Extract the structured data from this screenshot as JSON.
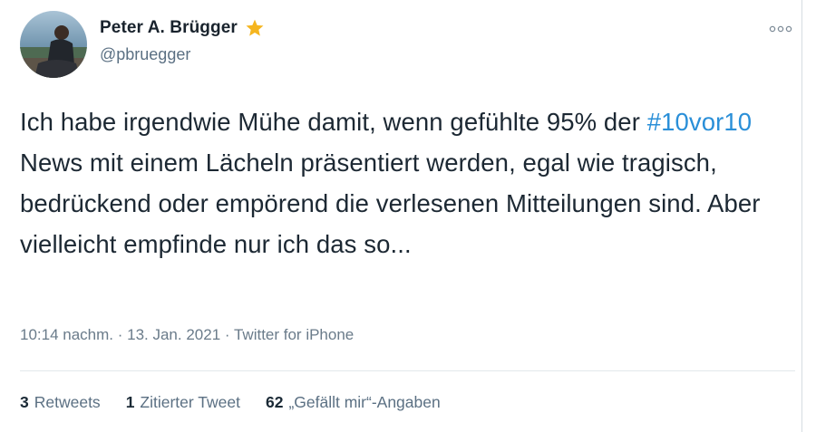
{
  "user": {
    "display_name": "Peter A. Brügger",
    "handle": "@pbruegger"
  },
  "icons": {
    "star": "star-icon",
    "more": "more-options-icon",
    "avatar": "profile-photo"
  },
  "colors": {
    "star": "#f5b51f",
    "hashtag": "#2a8fd8"
  },
  "tweet": {
    "text_before": "Ich habe irgendwie Mühe damit, wenn gefühlte 95% der ",
    "hashtag": "#10vor10",
    "text_after": " News mit einem Lächeln präsentiert werden, egal wie tragisch, bedrückend oder empörend die verlesenen Mitteilungen sind. Aber vielleicht empfinde nur ich das so..."
  },
  "meta": {
    "time": "10:14 nachm.",
    "separator": " · ",
    "date": "13. Jan. 2021",
    "source": "Twitter for iPhone"
  },
  "stats": {
    "retweets_count": "3",
    "retweets_label": "Retweets",
    "quotes_count": "1",
    "quotes_label": "Zitierter Tweet",
    "likes_count": "62",
    "likes_label": "„Gefällt mir“-Angaben"
  }
}
